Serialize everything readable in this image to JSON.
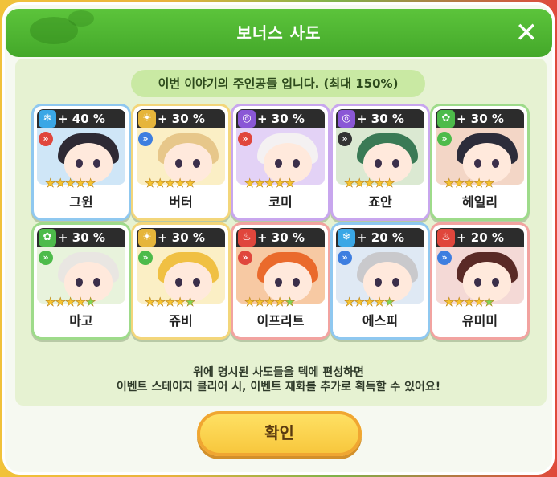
{
  "dialog": {
    "title": "보너스 사도",
    "subtitle": "이번 이야기의 주인공들 입니다. (최대 150%)",
    "info_line1": "위에 명시된 사도들을 덱에 편성하면",
    "info_line2": "이벤트 스테이지 클리어 시, 이벤트 재화를 추가로 획득할 수 있어요!",
    "confirm_label": "확인"
  },
  "characters": [
    {
      "name": "그윈",
      "bonus": "+ 40 %",
      "element": "snowflake",
      "element_color": "#3aa7e6",
      "role_color": "#e0463c",
      "stars": 5,
      "border": "#8fc8f0",
      "hair": "#2e2a34",
      "bg": "#cfe6f7"
    },
    {
      "name": "버터",
      "bonus": "+ 30 %",
      "element": "sun",
      "element_color": "#e6b53a",
      "role_color": "#3d7ee0",
      "stars": 5,
      "border": "#f3d67a",
      "hair": "#e7c78a",
      "bg": "#fbefc5"
    },
    {
      "name": "코미",
      "bonus": "+ 30 %",
      "element": "swirl",
      "element_color": "#8a57d6",
      "role_color": "#e0463c",
      "stars": 5,
      "border": "#c8a6ee",
      "hair": "#f4f1f2",
      "bg": "#e3d2f6"
    },
    {
      "name": "죠안",
      "bonus": "+ 30 %",
      "element": "swirl",
      "element_color": "#8a57d6",
      "role_color": "#333333",
      "stars": 5,
      "border": "#c8a6ee",
      "hair": "#3a7a55",
      "bg": "#dbe9d2"
    },
    {
      "name": "헤일리",
      "bonus": "+ 30 %",
      "element": "leaf",
      "element_color": "#4dbb4a",
      "role_color": "#4dbb4a",
      "stars": 5,
      "border": "#9edb8a",
      "hair": "#2c2c3a",
      "bg": "#f3d6c6"
    },
    {
      "name": "마고",
      "bonus": "+ 30 %",
      "element": "leaf",
      "element_color": "#4dbb4a",
      "role_color": "#4dbb4a",
      "stars": 4,
      "border": "#9edb8a",
      "hair": "#e9e6e2",
      "bg": "#e8f3dc"
    },
    {
      "name": "쥬비",
      "bonus": "+ 30 %",
      "element": "sun",
      "element_color": "#e6b53a",
      "role_color": "#4dbb4a",
      "stars": 4,
      "border": "#f3d67a",
      "hair": "#f0c043",
      "bg": "#fbefc5"
    },
    {
      "name": "이프리트",
      "bonus": "+ 30 %",
      "element": "fire",
      "element_color": "#e0463c",
      "role_color": "#e0463c",
      "stars": 4,
      "border": "#f2a3a0",
      "hair": "#ea6a2c",
      "bg": "#f7c9a3"
    },
    {
      "name": "에스피",
      "bonus": "+ 20 %",
      "element": "snowflake",
      "element_color": "#3aa7e6",
      "role_color": "#3d7ee0",
      "stars": 4,
      "border": "#8fc8f0",
      "hair": "#c9c9cc",
      "bg": "#dfe9f4"
    },
    {
      "name": "유미미",
      "bonus": "+ 20 %",
      "element": "fire",
      "element_color": "#e0463c",
      "role_color": "#3d7ee0",
      "stars": 4,
      "border": "#f2a3a0",
      "hair": "#5a2a26",
      "bg": "#f4d9d6"
    }
  ]
}
